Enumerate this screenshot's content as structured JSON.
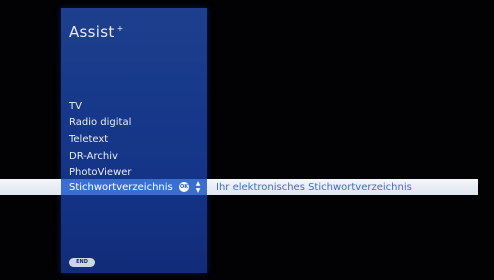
{
  "panel": {
    "title": "Assist",
    "title_mark": "+"
  },
  "menu": {
    "items": [
      {
        "label": "TV"
      },
      {
        "label": "Radio digital"
      },
      {
        "label": "Teletext"
      },
      {
        "label": "DR-Archiv"
      },
      {
        "label": "PhotoViewer"
      },
      {
        "label": "Stichwortverzeichnis",
        "selected": true
      }
    ]
  },
  "selection": {
    "ok_icon": "OK",
    "updown_up": "▲",
    "updown_down": "▼",
    "description": "Ihr elektronisches Stichwortverzeichnis"
  },
  "footer": {
    "end_label": "END"
  },
  "colors": {
    "panel_blue": "#17388a",
    "highlight_blue": "#3a6fcf",
    "bar_white": "#f4f6fa",
    "description_text": "#3c6fc9"
  }
}
